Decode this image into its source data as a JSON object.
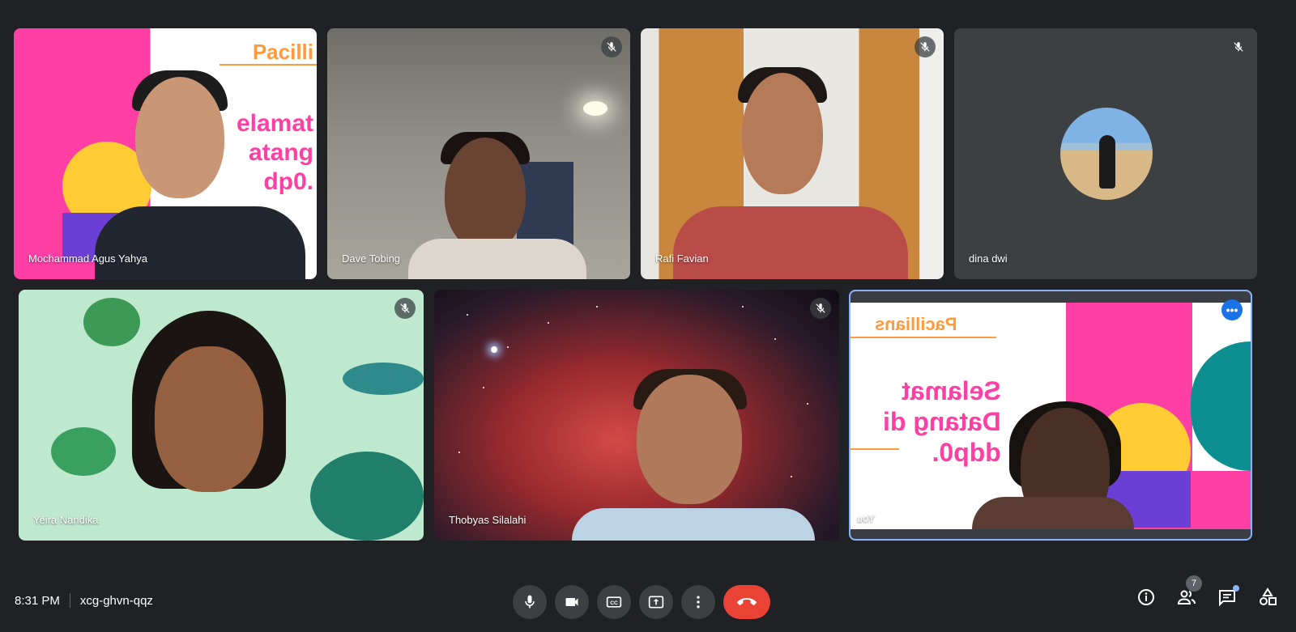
{
  "participants_row1": [
    {
      "name": "Mochammad Agus Yahya",
      "muted": false,
      "scene": "mochammad"
    },
    {
      "name": "Dave Tobing",
      "muted": true,
      "scene": "dave"
    },
    {
      "name": "Rafi Favian",
      "muted": true,
      "scene": "rafi"
    },
    {
      "name": "dina dwi",
      "muted": true,
      "scene": "dina"
    }
  ],
  "participants_row2": [
    {
      "name": "Yeira Nandika",
      "muted": true,
      "scene": "yeira"
    },
    {
      "name": "Thobyas Silalahi",
      "muted": true,
      "scene": "thobyas"
    },
    {
      "name": "You",
      "muted": false,
      "scene": "you",
      "active_speaker": true
    }
  ],
  "slides": {
    "brand": "Pacillians",
    "brand_cropped": "Pacilli",
    "welcome_lines": [
      "Selamat",
      "Datang di",
      "ddp0."
    ],
    "welcome_cropped_lines": [
      "elamat",
      "atang",
      "dp0."
    ]
  },
  "meeting": {
    "time": "8:31 PM",
    "code": "xcg-ghvn-qqz",
    "participant_count": "7"
  },
  "icons": {
    "mic": "mic-icon",
    "camera": "camera-icon",
    "captions": "captions-icon",
    "present": "present-icon",
    "more": "more-vert-icon",
    "end_call": "end-call-icon",
    "info": "info-icon",
    "people": "people-icon",
    "chat": "chat-icon",
    "activities": "activities-icon"
  },
  "colors": {
    "background": "#202124",
    "tile": "#3c4043",
    "end_call": "#ea4335",
    "active_border": "#8ab4f8",
    "accent_blue": "#1a73e8"
  }
}
